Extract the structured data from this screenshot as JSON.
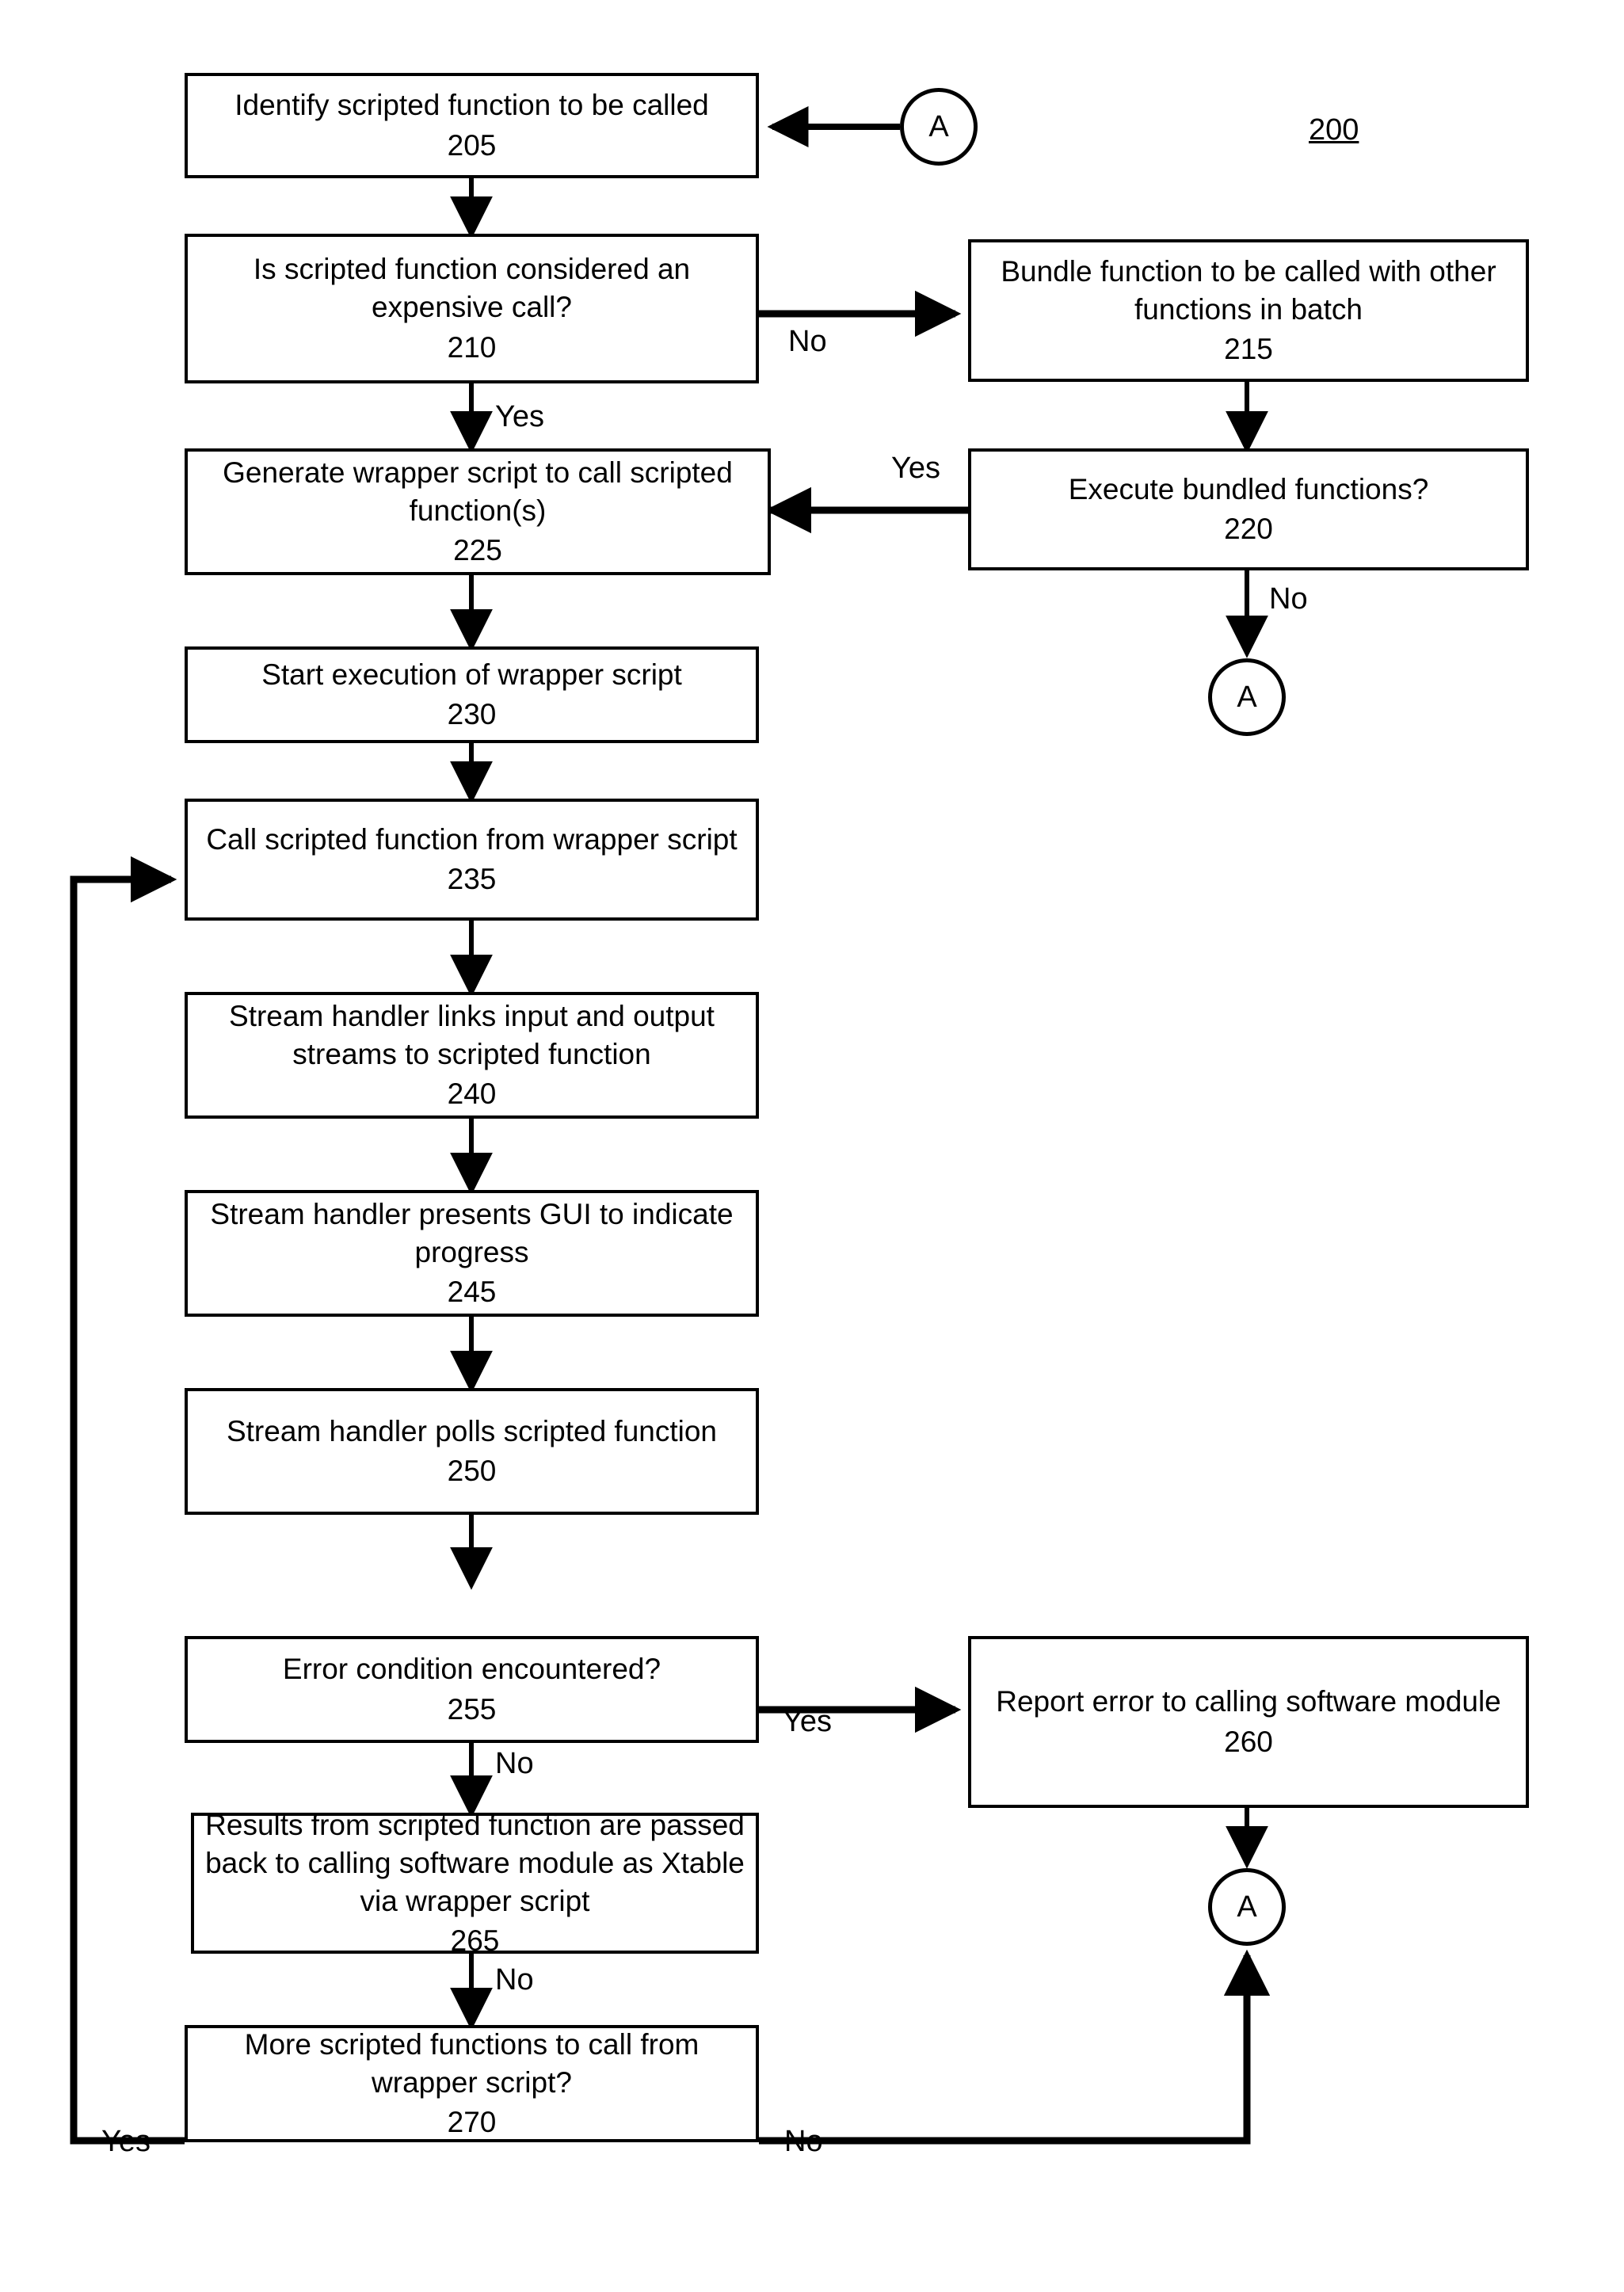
{
  "figure": {
    "reference_number": "200"
  },
  "nodes": [
    {
      "id": "205",
      "label": "Identify scripted function to be called",
      "number": "205"
    },
    {
      "id": "210",
      "label": "Is scripted function considered an expensive call?",
      "number": "210"
    },
    {
      "id": "215",
      "label": "Bundle function to be called with other functions in batch",
      "number": "215"
    },
    {
      "id": "220",
      "label": "Execute bundled functions?",
      "number": "220"
    },
    {
      "id": "225",
      "label": "Generate wrapper script to call scripted function(s)",
      "number": "225"
    },
    {
      "id": "230",
      "label": "Start execution of wrapper script",
      "number": "230"
    },
    {
      "id": "235",
      "label": "Call scripted function from wrapper script",
      "number": "235"
    },
    {
      "id": "240",
      "label": "Stream handler links input and output streams to scripted function",
      "number": "240"
    },
    {
      "id": "245",
      "label": "Stream handler presents GUI to indicate progress",
      "number": "245"
    },
    {
      "id": "250",
      "label": "Stream handler polls scripted function",
      "number": "250"
    },
    {
      "id": "255",
      "label": "Error condition encountered?",
      "number": "255"
    },
    {
      "id": "260",
      "label": "Report error to calling software module",
      "number": "260"
    },
    {
      "id": "265",
      "label": "Results from scripted function are passed back to calling software module as Xtable via wrapper script",
      "number": "265"
    },
    {
      "id": "270",
      "label": "More scripted functions to call from wrapper script?",
      "number": "270"
    }
  ],
  "connectors": [
    {
      "id": "a-top",
      "label": "A"
    },
    {
      "id": "a-middle",
      "label": "A"
    },
    {
      "id": "a-bottom",
      "label": "A"
    }
  ],
  "edge_labels": [
    {
      "id": "no-210-215",
      "text": "No"
    },
    {
      "id": "yes-210-225",
      "text": "Yes"
    },
    {
      "id": "yes-220-225",
      "text": "Yes"
    },
    {
      "id": "no-220-a",
      "text": "No"
    },
    {
      "id": "yes-255-260",
      "text": "Yes"
    },
    {
      "id": "no-255-265",
      "text": "No"
    },
    {
      "id": "no-265-270",
      "text": "No"
    },
    {
      "id": "yes-270-loop",
      "text": "Yes"
    },
    {
      "id": "no-270-a",
      "text": "No"
    }
  ]
}
